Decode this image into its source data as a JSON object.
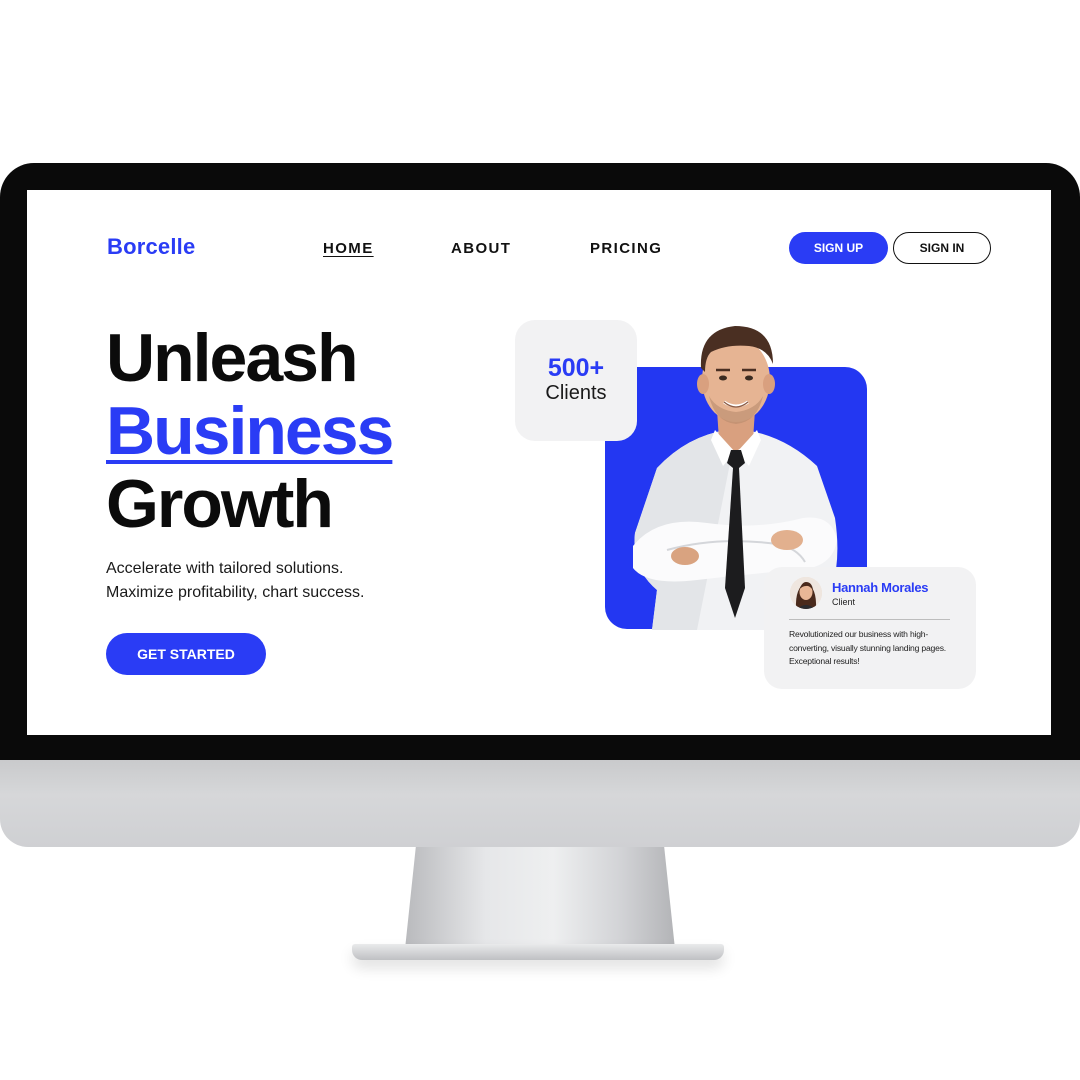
{
  "nav": {
    "logo": "Borcelle",
    "links": [
      "HOME",
      "ABOUT",
      "PRICING"
    ],
    "active_link": "HOME",
    "sign_up_label": "SIGN UP",
    "sign_in_label": "SIGN IN"
  },
  "hero": {
    "title_lines": [
      "Unleash",
      "Business",
      "Growth"
    ],
    "highlight_line": "Business",
    "subtitle_lines": [
      "Accelerate with tailored solutions.",
      "Maximize profitability, chart success."
    ],
    "cta_label": "GET STARTED"
  },
  "stats": {
    "number": "500+",
    "label": "Clients"
  },
  "testimonial": {
    "name": "Hannah Morales",
    "role": "Client",
    "text": "Revolutionized our business with high-converting, visually stunning landing pages. Exceptional results!"
  },
  "colors": {
    "accent": "#2a3cf5",
    "card_bg": "#f2f2f3",
    "text": "#0b0b0b",
    "bezel": "#0a0a0a"
  }
}
